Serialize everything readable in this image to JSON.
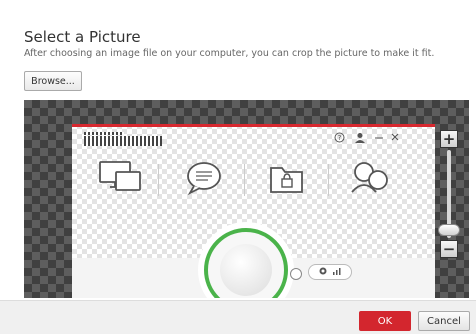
{
  "dialog": {
    "title": "Select a Picture",
    "subtitle": "After choosing an image file on your computer, you can crop the picture to make it fit.",
    "browse_label": "Browse..."
  },
  "zoom": {
    "plus_label": "+",
    "minus_label": "−",
    "level": 0.15
  },
  "preview_icons": [
    "devices-icon",
    "chat-bubble-icon",
    "locked-folder-icon",
    "people-icon"
  ],
  "footer": {
    "ok_label": "OK",
    "cancel_label": "Cancel"
  },
  "colors": {
    "accent": "#d3262e",
    "ring": "#4ab34a"
  }
}
